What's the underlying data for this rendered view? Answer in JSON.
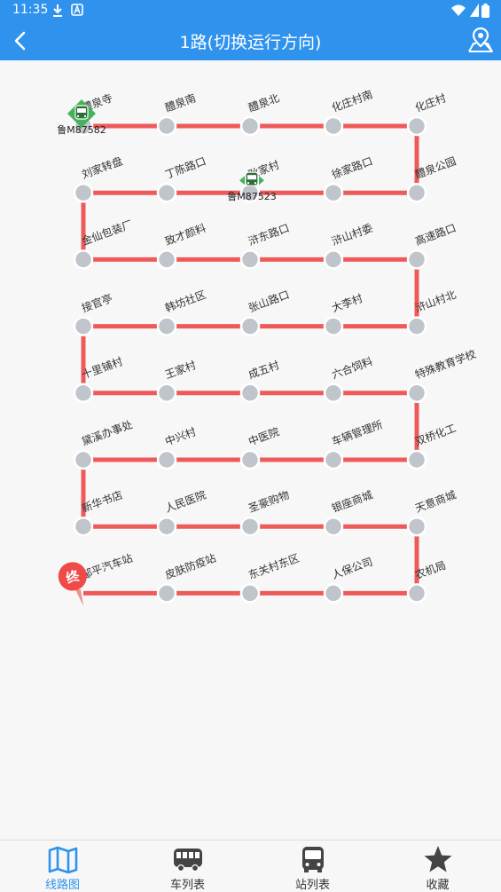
{
  "status_bar": {
    "time": "11:35"
  },
  "header": {
    "title": "1路(切换运行方向)"
  },
  "route": {
    "stations": [
      "醴泉寺",
      "醴泉南",
      "醴泉北",
      "化庄村南",
      "化庄村",
      "醴泉公园",
      "徐家路口",
      "耿家村",
      "丁陈路口",
      "刘家转盘",
      "金仙包装厂",
      "致才颜料",
      "浒东路口",
      "浒山村委",
      "高速路口",
      "浒山村北",
      "大李村",
      "张山路口",
      "韩坊社区",
      "接官亭",
      "十里铺村",
      "王家村",
      "成五村",
      "六合饲料",
      "特殊教育学校",
      "双桥化工",
      "车辆管理所",
      "中医院",
      "中兴村",
      "黛溪办事处",
      "新华书店",
      "人民医院",
      "圣豪购物",
      "银座商城",
      "天意商城",
      "农机局",
      "人保公司",
      "东关村东区",
      "皮肤防疫站",
      "邹平汽车站"
    ],
    "buses": [
      {
        "plate": "鲁M87582",
        "near_station": "醴泉寺"
      },
      {
        "plate": "鲁M87523",
        "near_station": "丁陈路口"
      }
    ],
    "end_marker": "终",
    "line_color": "#ee5a5a"
  },
  "bottom_nav": {
    "tabs": [
      {
        "label": "线路图",
        "active": true
      },
      {
        "label": "车列表",
        "active": false
      },
      {
        "label": "站列表",
        "active": false
      },
      {
        "label": "收藏",
        "active": false
      }
    ]
  },
  "colors": {
    "primary": "#2f93ee",
    "route_line": "#ee5a5a",
    "station_dot": "#c0c5cc",
    "bus_green": "#2fa64b"
  }
}
